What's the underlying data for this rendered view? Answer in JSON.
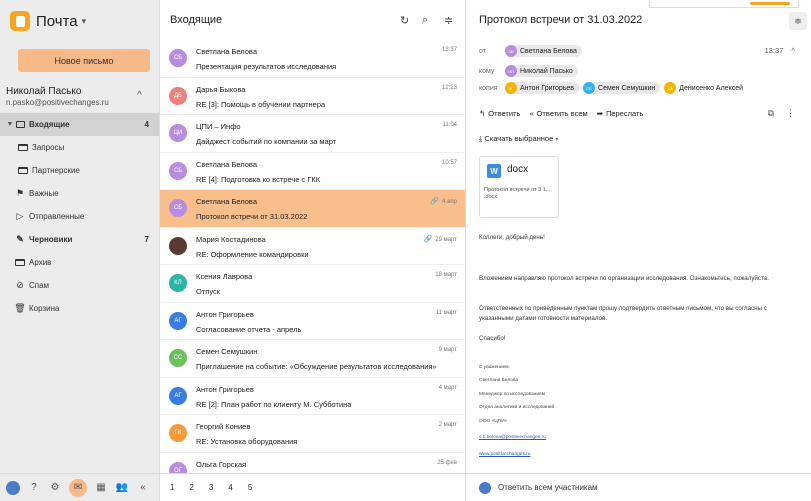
{
  "app": {
    "name": "Почта",
    "compose_label": "Новое письмо"
  },
  "user": {
    "name": "Николай Пасько",
    "email": "n.pasko@positivechanges.ru"
  },
  "folders": [
    {
      "label": "Входящие",
      "count": "4",
      "icon": "inbox-icon"
    },
    {
      "label": "Запросы",
      "count": "",
      "icon": "folder-icon"
    },
    {
      "label": "Партнерские",
      "count": "",
      "icon": "folder-icon"
    },
    {
      "label": "Важные",
      "count": "",
      "icon": "important-icon"
    },
    {
      "label": "Отправленные",
      "count": "",
      "icon": "sent-icon"
    },
    {
      "label": "Черновики",
      "count": "7",
      "icon": "drafts-icon"
    },
    {
      "label": "Архив",
      "count": "",
      "icon": "archive-icon"
    },
    {
      "label": "Спам",
      "count": "",
      "icon": "spam-icon"
    },
    {
      "label": "Корзина",
      "count": "",
      "icon": "trash-icon"
    }
  ],
  "list": {
    "title": "Входящие",
    "pages": [
      "1",
      "2",
      "3",
      "4",
      "5"
    ],
    "messages": [
      {
        "initials": "СБ",
        "color": "#b88de0",
        "sender": "Светлана Белова",
        "subject": "Презентация результатов исследования",
        "time": "13:37"
      },
      {
        "initials": "ДБ",
        "color": "#ee7f7a",
        "sender": "Дарья Быкова",
        "subject": "RE [3]: Помощь в обучении партнера",
        "time": "12:23"
      },
      {
        "initials": "ЦИ",
        "color": "#b88de0",
        "sender": "ЦПИ – Инфо",
        "subject": "Дайджест событий по компании за март",
        "time": "11:04"
      },
      {
        "initials": "СБ",
        "color": "#b88de0",
        "sender": "Светлана Белова",
        "subject": "RE [4]: Подготовка ко встрече с ГКК",
        "time": "10:57"
      },
      {
        "initials": "СБ",
        "color": "#b88de0",
        "sender": "Светлана Белова",
        "subject": "Протокол встречи от 31.03.2022",
        "time": "4 апр"
      },
      {
        "initials": "",
        "color": "#5a3b33",
        "sender": "Мария Костадинова",
        "subject": "RE: Оформление командировки",
        "time": "29 март"
      },
      {
        "initials": "КЛ",
        "color": "#2bb6a4",
        "sender": "Ксения Лаврова",
        "subject": "Отпуск",
        "time": "18 март"
      },
      {
        "initials": "АГ",
        "color": "#3a7de0",
        "sender": "Антон Григорьев",
        "subject": "Согласование отчета - апрель",
        "time": "11 март"
      },
      {
        "initials": "СС",
        "color": "#6cc05b",
        "sender": "Семен Семушкин",
        "subject": "Приглашение на событие: «Обсуждение результатов исследования»",
        "time": "9 март"
      },
      {
        "initials": "АГ",
        "color": "#3a7de0",
        "sender": "Антон Григорьев",
        "subject": "RE [2]: План работ по клиенту М. Субботина",
        "time": "4 март"
      },
      {
        "initials": "ГК",
        "color": "#f59a3a",
        "sender": "Георгий Кониев",
        "subject": "RE: Установка оборудования",
        "time": "2 март"
      },
      {
        "initials": "ОГ",
        "color": "#b88de0",
        "sender": "Ольга Горская",
        "subject": "",
        "time": "25 фев"
      }
    ]
  },
  "reader": {
    "title": "Протокол встречи от 31.03.2022",
    "from_label": "от",
    "to_label": "кому",
    "cc_label": "копия",
    "from": {
      "initials": "СБ",
      "name": "Светлана Белова",
      "color": "#b88de0"
    },
    "to": {
      "initials": "НП",
      "name": "Николай Пасько",
      "color": "#b88de0"
    },
    "cc": [
      {
        "initials": "АГ",
        "name": "Антон Григорьев",
        "color": "#f6b400"
      },
      {
        "initials": "СС",
        "name": "Семен Семушкин",
        "color": "#3ab0e8"
      },
      {
        "initials": "ДА",
        "name": "Денисенко Алексей",
        "color": "#f6b400"
      }
    ],
    "time": "13:37",
    "reply_label": "Ответить",
    "reply_all_label": "Ответить всем",
    "forward_label": "Переслать",
    "download_label": "Скачать выбранное",
    "attachment": {
      "ext": "docx",
      "icon_letter": "W",
      "name": "Протокол встречи от 3 1.... .docx"
    },
    "greeting": "Коллеги, добрый день!",
    "para1": "Вложением направляю протокол встречи по организации исследования. Ознакомьтесь, пожалуйста.",
    "para2": "Ответственных по приведенным пунктам прошу подтвердить ответным письмом, что вы согласны с указанными датами готовности материалов.",
    "thanks": "Спасибо!",
    "signature": {
      "regards": "С уважением,",
      "name": "Светлана Белова",
      "position": "Менеджер по исследованиям",
      "department": "Отдел аналитики и исследований",
      "company": "ООО «ЦПИ»",
      "email": "s.b.belova@positivechanges.ru",
      "site": "www.positivechanges.ru"
    },
    "reply_all_bar": "Ответить всем участникам"
  }
}
